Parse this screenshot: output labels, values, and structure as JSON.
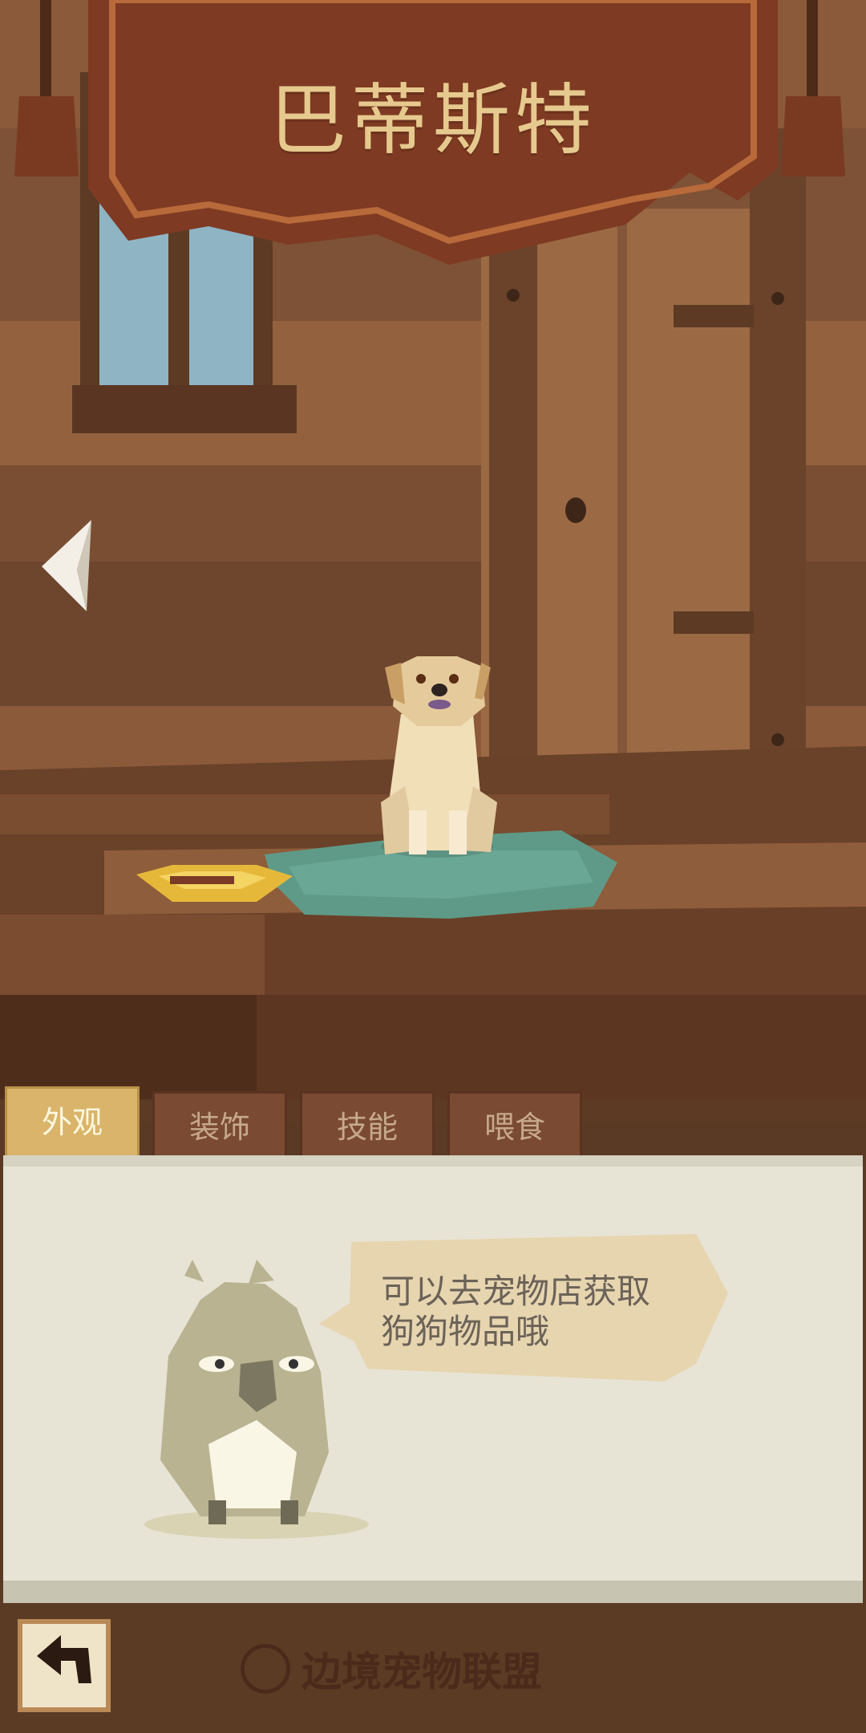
{
  "header": {
    "pet_name": "巴蒂斯特"
  },
  "navigation": {
    "prev_icon": "arrow-left-icon"
  },
  "tabs": [
    {
      "label": "外观",
      "active": true
    },
    {
      "label": "装饰",
      "active": false
    },
    {
      "label": "技能",
      "active": false
    },
    {
      "label": "喂食",
      "active": false
    }
  ],
  "panel": {
    "hint_line1": "可以去宠物店获取",
    "hint_line2": "狗狗物品哦"
  },
  "footer": {
    "back_icon": "return-arrow-icon",
    "watermark": "边境宠物联盟"
  },
  "colors": {
    "banner": "#7e3a22",
    "title": "#e6c98e",
    "tab_active": "#d9b46a",
    "panel": "#e7e4d6"
  }
}
